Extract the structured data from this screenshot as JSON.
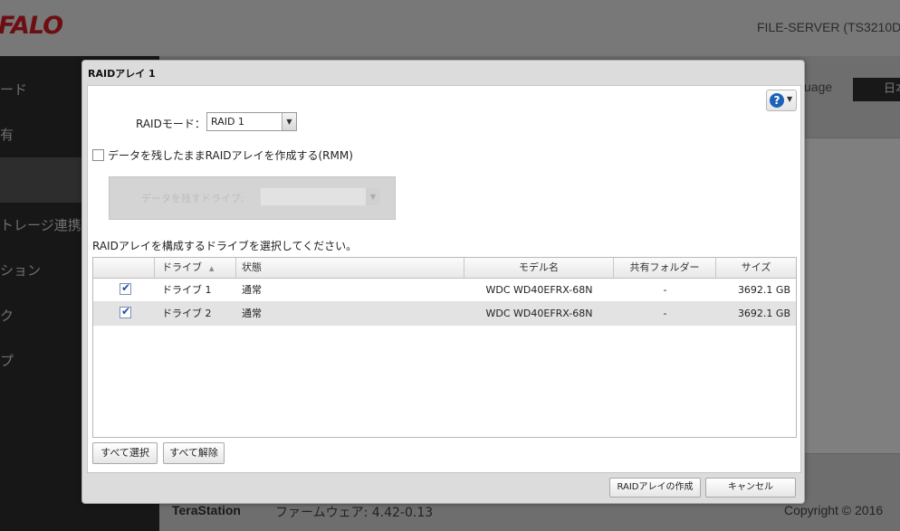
{
  "app": {
    "logo": "FALO",
    "server_name": "FILE-SERVER (TS3210D",
    "sidebar_items": [
      {
        "label": "ード"
      },
      {
        "label": "有"
      },
      {
        "label": ""
      },
      {
        "label": "トレージ連携"
      },
      {
        "label": "ション"
      },
      {
        "label": "ク"
      },
      {
        "label": "プ"
      }
    ],
    "language_label": "uage",
    "language_value": "日本",
    "footer": {
      "brand": "TeraStation",
      "firmware": "ファームウェア: 4.42-0.13",
      "copyright": "Copyright © 2016"
    }
  },
  "dialog": {
    "title": "RAIDアレイ 1",
    "help_icon": "?",
    "raid_mode_label": "RAIDモード：",
    "raid_mode_value": "RAID 1",
    "rmm_checkbox_label": "データを残したままRAIDアレイを作成する(RMM)",
    "rmm_checked": false,
    "rmm_drive_label": "データを残すドライブ:",
    "instruction": "RAIDアレイを構成するドライブを選択してください。",
    "columns": [
      "ドライブ",
      "状態",
      "モデル名",
      "共有フォルダー",
      "サイズ"
    ],
    "rows": [
      {
        "checked": true,
        "drive": "ドライブ 1",
        "status": "通常",
        "model": "WDC WD40EFRX-68N",
        "share": "-",
        "size": "3692.1 GB"
      },
      {
        "checked": true,
        "drive": "ドライブ 2",
        "status": "通常",
        "model": "WDC WD40EFRX-68N",
        "share": "-",
        "size": "3692.1 GB"
      }
    ],
    "select_all": "すべて選択",
    "deselect_all": "すべて解除",
    "create_button": "RAIDアレイの作成",
    "cancel_button": "キャンセル"
  }
}
